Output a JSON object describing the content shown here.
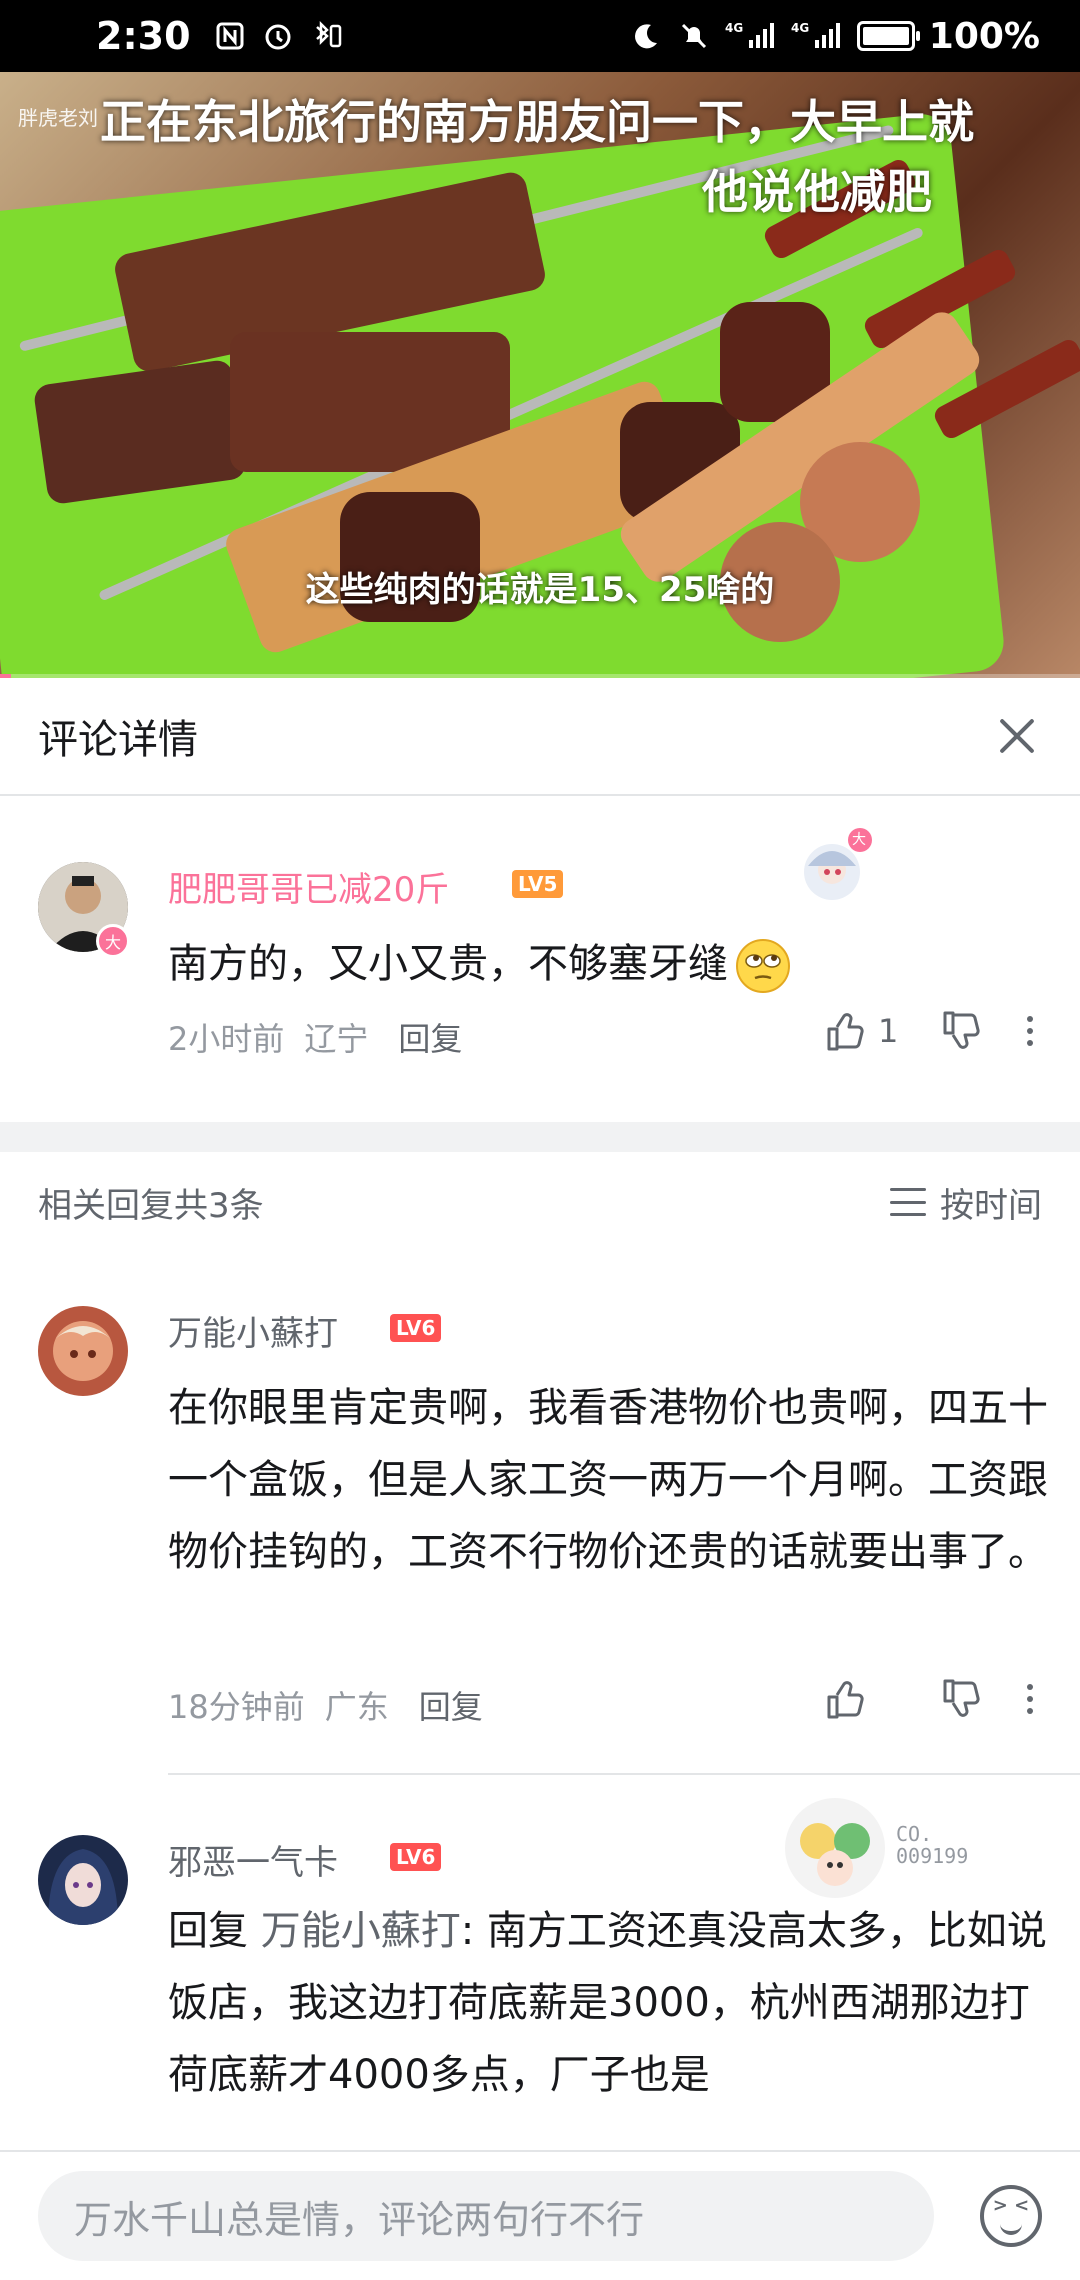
{
  "status_bar": {
    "time": "2:30",
    "network": "4G",
    "battery_text": "100%",
    "battery_level": 1.0
  },
  "video": {
    "watermark": "胖虎老刘",
    "title_line1": "正在东北旅行的南方朋友问一下，大早上就",
    "title_line2": "他说他减肥",
    "subtitle": "这些纯肉的话就是15、25啥的",
    "progress": 0.01
  },
  "header": {
    "title": "评论详情"
  },
  "main_comment": {
    "user": "肥肥哥哥已减20斤",
    "level": "LV5",
    "avatar_badge": "大",
    "text": "南方的，又小又贵，不够塞牙缝",
    "emoji": "🙄",
    "time": "2小时前",
    "location": "辽宁",
    "reply_label": "回复",
    "like_count": "1",
    "pendant_badge": "大"
  },
  "replies_header": {
    "count_text": "相关回复共3条",
    "sort_label": "按时间"
  },
  "replies": [
    {
      "user": "万能小蘇打",
      "level": "LV6",
      "text": "在你眼里肯定贵啊，我看香港物价也贵啊，四五十一个盒饭，但是人家工资一两万一个月啊。工资跟物价挂钩的，工资不行物价还贵的话就要出事了。",
      "time": "18分钟前",
      "location": "广东",
      "reply_label": "回复"
    },
    {
      "user": "邪恶一气卡",
      "level": "LV6",
      "reply_prefix": "回复",
      "mention": "万能小蘇打",
      "text": ": 南方工资还真没高太多，比如说饭店，我这边打荷底薪是3000，杭州西湖那边打荷底薪才4000多点，厂子也是",
      "pendant_text": "CO.\n009199"
    }
  ],
  "input_bar": {
    "placeholder": "万水千山总是情，评论两句行不行"
  },
  "colors": {
    "accent_pink": "#fb7299",
    "username_pink": "#fb7299",
    "text_gray": "#9499a0",
    "lv5": "#ff9a39",
    "lv6": "#ff5252"
  }
}
